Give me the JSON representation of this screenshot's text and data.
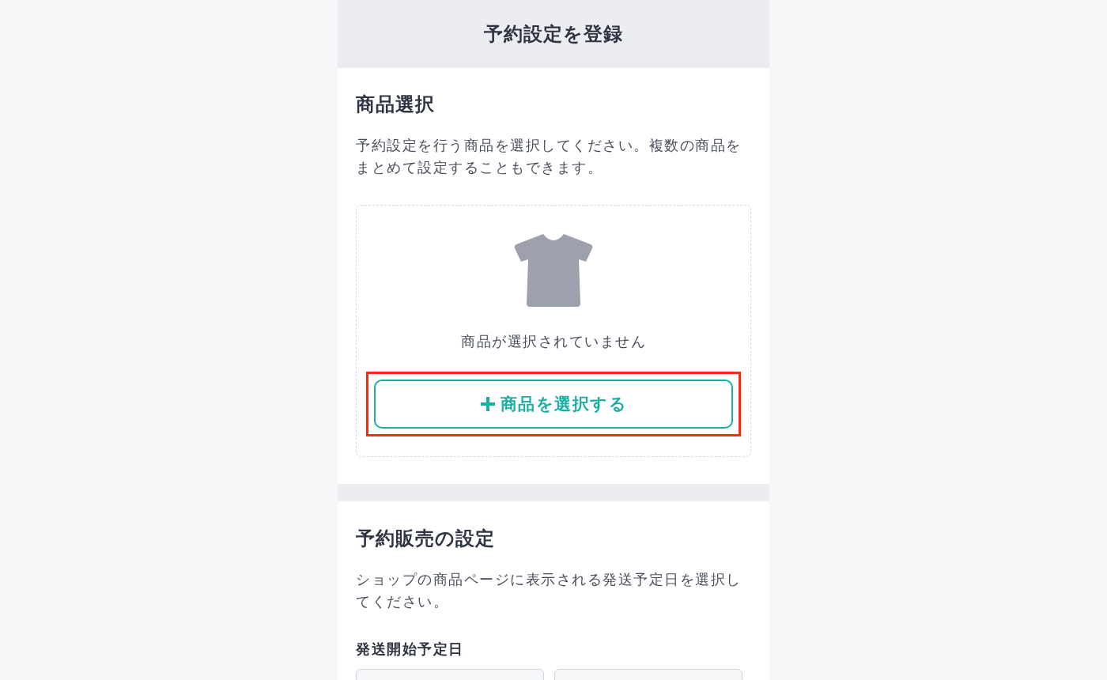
{
  "header": {
    "title": "予約設定を登録"
  },
  "product_selection": {
    "heading": "商品選択",
    "description": "予約設定を行う商品を選択してください。複数の商品をまとめて設定することもできます。",
    "empty_state": {
      "message": "商品が選択されていません"
    },
    "select_button": {
      "label": "商品を選択する",
      "highlighted": true
    }
  },
  "preorder_settings": {
    "heading": "予約販売の設定",
    "description": "ショップの商品ページに表示される発送予定日を選択してください。",
    "ship_start_date": {
      "label": "発送開始予定日",
      "fields": [
        {
          "kind": "input"
        },
        {
          "kind": "input"
        }
      ]
    }
  }
}
